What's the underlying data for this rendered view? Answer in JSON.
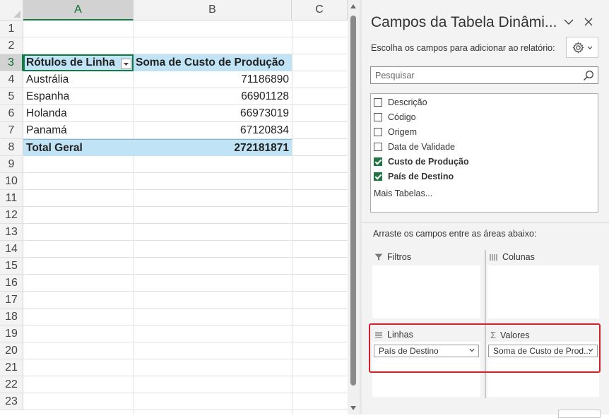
{
  "sheet": {
    "columns": [
      "A",
      "B",
      "C"
    ],
    "rows": [
      "1",
      "2",
      "3",
      "4",
      "5",
      "6",
      "7",
      "8",
      "9",
      "10",
      "11",
      "12",
      "13",
      "14",
      "15",
      "16",
      "17",
      "18",
      "19",
      "20",
      "21",
      "22",
      "23"
    ],
    "pivot": {
      "header_row_label": "Rótulos de Linha",
      "header_value_label": "Soma de Custo de Produção",
      "rows": [
        {
          "label": "Austrália",
          "value": "71186890"
        },
        {
          "label": "Espanha",
          "value": "66901128"
        },
        {
          "label": "Holanda",
          "value": "66973019"
        },
        {
          "label": "Panamá",
          "value": "67120834"
        }
      ],
      "total_label": "Total Geral",
      "total_value": "272181871"
    }
  },
  "panel": {
    "title": "Campos da Tabela Dinâmi...",
    "choose_label": "Escolha os campos para adicionar ao relatório:",
    "search_placeholder": "Pesquisar",
    "fields": [
      {
        "label": "Descrição",
        "checked": false
      },
      {
        "label": "Código",
        "checked": false
      },
      {
        "label": "Origem",
        "checked": false
      },
      {
        "label": "Data de Validade",
        "checked": false
      },
      {
        "label": "Custo de Produção",
        "checked": true
      },
      {
        "label": "País de Destino",
        "checked": true
      }
    ],
    "more_tables": "Mais Tabelas...",
    "drag_hint": "Arraste os campos entre as áreas abaixo:",
    "areas": {
      "filters": "Filtros",
      "columns": "Colunas",
      "rows": "Linhas",
      "values": "Valores",
      "rows_item": "País de Destino",
      "values_item": "Soma de Custo de Prod..."
    }
  },
  "colors": {
    "excel_green": "#107c41",
    "pivot_blue": "#c0e4f5",
    "highlight_red": "#d2202c"
  }
}
